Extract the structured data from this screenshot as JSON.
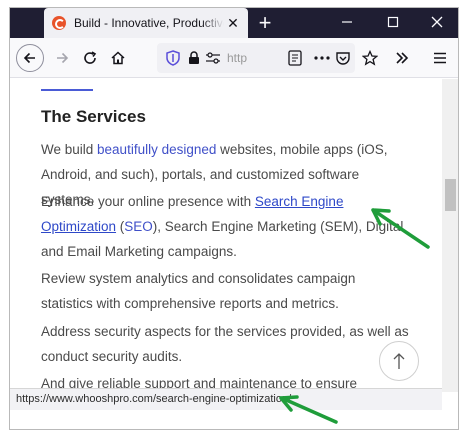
{
  "browser": {
    "tab_title": "Build - Innovative, Productive, R",
    "tab_close": "✕",
    "new_tab": "+",
    "url_text": "http",
    "colors": {
      "tabbar": "#1f1e33",
      "link": "#2e48c8"
    }
  },
  "page": {
    "heading": "The Services",
    "p1_before": "We build ",
    "p1_link": "beautifully designed",
    "p1_after": " websites, mobile apps (iOS, Android, and such), portals, and customized software systems.",
    "p2_before": "Enhance your online presence with ",
    "p2_link": "Search Engine Optimization",
    "p2_paren_open": " (",
    "p2_link2": "SEO",
    "p2_after": "), Search Engine Marketing (SEM), Digital and Email Marketing campaigns.",
    "p3": "Review system analytics and consolidates campaign statistics with comprehensive reports and metrics.",
    "p4": "Address security aspects for the services provided, as well as conduct security audits.",
    "p5": "And give reliable support and maintenance to ensure continuity."
  },
  "status": {
    "hover_url": "https://www.whooshpro.com/search-engine-optimization/"
  },
  "annotations": {
    "arrow_color": "#1f9d3a"
  }
}
